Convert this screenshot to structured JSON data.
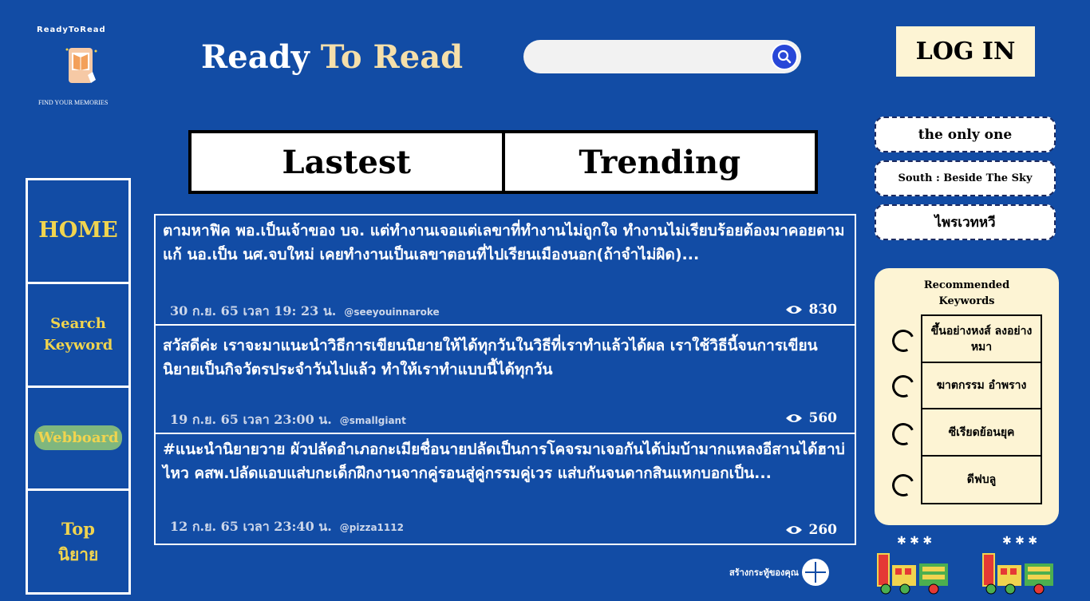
{
  "logo": {
    "top_text": "ReadyToRead",
    "bottom_text": "FIND YOUR MEMORIES"
  },
  "header": {
    "title_main": "Ready ",
    "title_accent": "To Read",
    "search_placeholder": "",
    "login_label": "LOG IN"
  },
  "tabs": [
    {
      "label": "Lastest"
    },
    {
      "label": "Trending"
    }
  ],
  "sidebar": {
    "items": [
      {
        "label": "HOME"
      },
      {
        "label": "Search Keyword"
      },
      {
        "label": "Webboard"
      },
      {
        "label": "Top นิยาย"
      }
    ]
  },
  "posts": [
    {
      "text": "ตามหาฟิค พอ.เป็นเจ้าของ บจ. แต่ทำงานเจอแต่เลขาที่ทำงานไม่ถูกใจ ทำงานไม่เรียบร้อยต้องมาคอยตามแก้ นอ.เป็น นศ.จบใหม่ เคยทำงานเป็นเลขาตอนที่ไปเรียนเมืองนอก(ถ้าจำไม่ผิด)...",
      "date": "30 ก.ย. 65 เวลา 19: 23 น.",
      "user": "@seeyouinnaroke",
      "views": "830"
    },
    {
      "text": "สวัสดีค่ะ เราจะมาแนะนำวิธีการเขียนนิยายให้ได้ทุกวันในวิธีที่เราทำแล้วได้ผล เราใช้วิธีนี้จนการเขียนนิยายเป็นกิจวัตรประจำวันไปแล้ว ทำให้เราทำแบบนี้ได้ทุกวัน",
      "date": "19 ก.ย. 65 เวลา 23:00 น.",
      "user": "@smallgiant",
      "views": "560"
    },
    {
      "text": "#แนะนำนิยายวาย ผัวปลัดอำเภอกะเมียชื่อนายปลัดเป็นการโคจรมาเจอกันได้บ่มบ้ามากแหลงอีสานได้ฮาบ่ไหว คสพ.ปลัดแอบแส่บกะเด็กฝึกงานจากคู่รอนสู่คู่กรรมคู่เวร แส่บกันจนดากสินแหกบอกเป็น...",
      "date": "12 ก.ย. 65 เวลา 23:40 น.",
      "user": "@pizza1112",
      "views": "260"
    }
  ],
  "quick_links": [
    {
      "label": "the only one"
    },
    {
      "label": "South : Beside The Sky"
    },
    {
      "label": "ไพรเวทหวี"
    }
  ],
  "recommended": {
    "title": "Recommended Keywords",
    "items": [
      {
        "label": "ขึ้นอย่างหงส์ ลงอย่างหมา"
      },
      {
        "label": "ฆาตกรรม อำพราง"
      },
      {
        "label": "ซีเรียดย้อนยุค"
      },
      {
        "label": "ดีฟบลู"
      }
    ]
  },
  "create_label": "สร้างกระทู้ของคุณ",
  "colors": {
    "background": "#124ca5",
    "accent_gold": "#f0d44f",
    "cream": "#fdf4d4",
    "search_button": "#2847d8"
  }
}
